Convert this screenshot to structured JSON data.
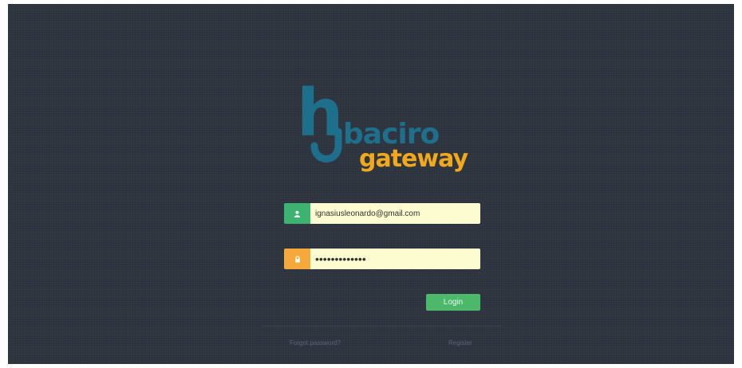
{
  "logo": {
    "monogram": "h",
    "line1": "baciro",
    "line2": "gateway",
    "primary_color": "#1e6f8c",
    "accent_color": "#f2a81d"
  },
  "login_form": {
    "email": {
      "icon": "user-icon",
      "icon_bg": "#3cb371",
      "value": "ignasiusleonardo@gmail.com"
    },
    "password": {
      "icon": "lock-icon",
      "icon_bg": "#f5a93a",
      "value": "•••••••••••••"
    },
    "login_label": "Login",
    "login_color": "#4bb86a"
  },
  "footer": {
    "forgot_label": "Forgot password?",
    "register_label": "Register"
  }
}
